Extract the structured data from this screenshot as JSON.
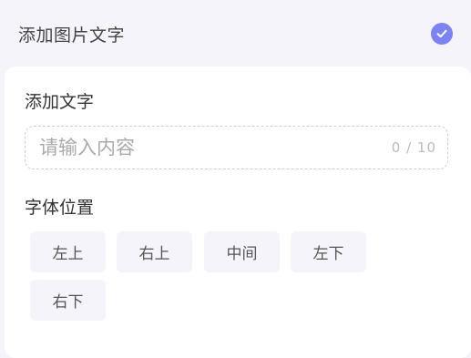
{
  "add_image_text": {
    "label": "添加图片文字",
    "checked": true,
    "check_color": "#7d82f4"
  },
  "text_section": {
    "title": "添加文字",
    "input": {
      "value": "",
      "placeholder": "请输入内容",
      "counter": "0 / 10"
    }
  },
  "position_section": {
    "title": "字体位置",
    "options": [
      "左上",
      "右上",
      "中间",
      "左下",
      "右下"
    ]
  }
}
